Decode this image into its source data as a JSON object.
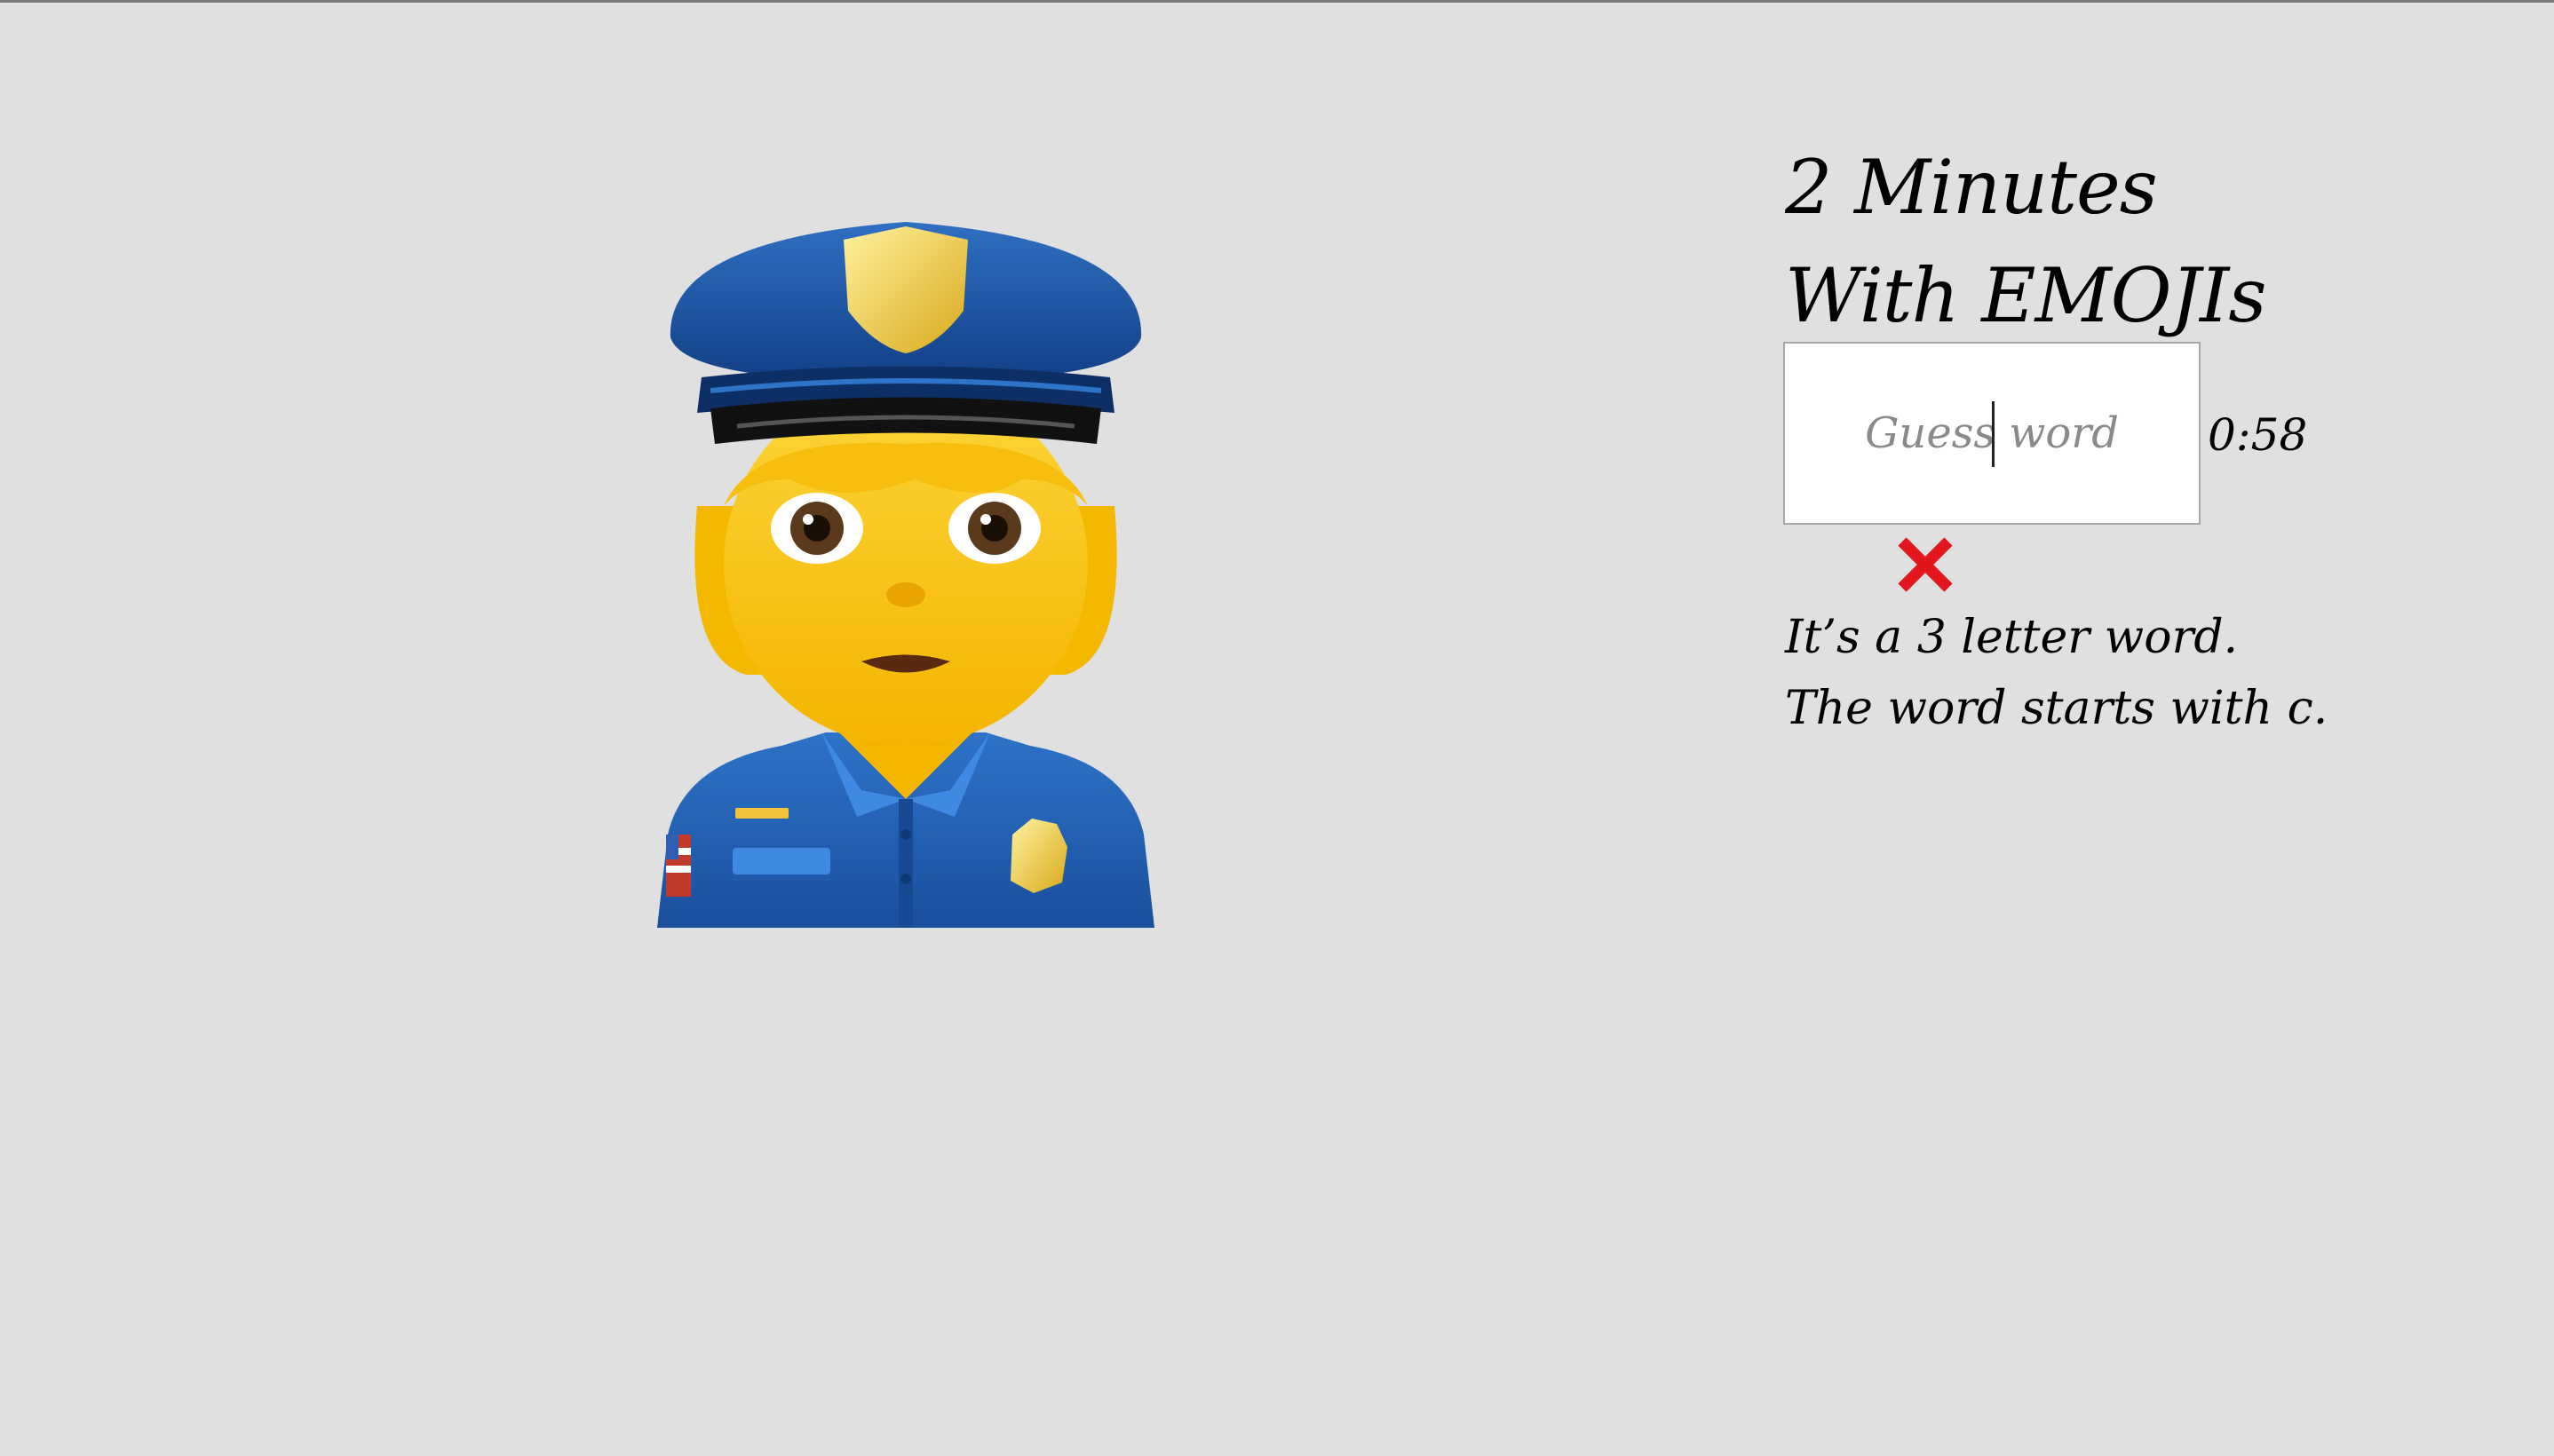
{
  "game": {
    "title": "2 Minutes With EMOJIs",
    "emoji": {
      "icon": "police-officer-emoji",
      "description_colors": {
        "skin": "#f7c320",
        "uniform": "#1f5fb0",
        "badge": "#f2d24a"
      }
    },
    "guess_input": {
      "placeholder": "Guess word",
      "value": ""
    },
    "timer": "0:58",
    "result_icon": "wrong-x-icon",
    "result_color": "#e1161c",
    "hints": [
      "It’s a 3 letter word.",
      "The word starts with c."
    ]
  }
}
